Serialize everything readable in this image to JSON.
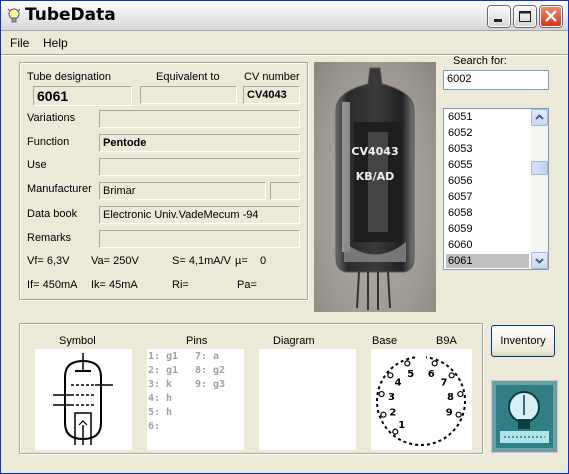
{
  "window": {
    "title": "TubeData"
  },
  "menu": {
    "file": "File",
    "help": "Help"
  },
  "info": {
    "tube_designation_label": "Tube designation",
    "tube_designation": "6061",
    "equivalent_label": "Equivalent to",
    "equivalent": "",
    "cv_number_label": "CV number",
    "cv_number": "CV4043",
    "variations_label": "Variations",
    "variations": "",
    "function_label": "Function",
    "function": "Pentode",
    "use_label": "Use",
    "use": "",
    "manufacturer_label": "Manufacturer",
    "manufacturer": "Brimar",
    "manufacturer_extra": "",
    "data_book_label": "Data book",
    "data_book": "Electronic Univ.VadeMecum -94",
    "remarks_label": "Remarks",
    "remarks": "",
    "params_row1": [
      "Vf= 6,3V",
      "Va= 250V",
      "S= 4,1mA/V",
      "µ=",
      "0"
    ],
    "params_row2": [
      "If= 450mA",
      "Ik= 45mA",
      "Ri=",
      "Pa="
    ]
  },
  "photo": {
    "print_line1": "CV4043",
    "print_line2": "KB/AD"
  },
  "search": {
    "label": "Search for:",
    "value": "6002",
    "results": [
      "6051",
      "6052",
      "6053",
      "6055",
      "6056",
      "6057",
      "6058",
      "6059",
      "6060",
      "6061"
    ],
    "selected": "6061"
  },
  "bottom": {
    "symbol_label": "Symbol",
    "pins_label": "Pins",
    "diagram_label": "Diagram",
    "base_label": "Base",
    "base_type": "B9A",
    "pins_col1": [
      "1: g1",
      "2: g1",
      "3: k",
      "4: h",
      "5: h",
      "6:"
    ],
    "pins_col2": [
      "7: a",
      "8: g2",
      "9: g3"
    ],
    "base_pins": [
      "1",
      "2",
      "3",
      "4",
      "5",
      "6",
      "7",
      "8",
      "9"
    ]
  },
  "buttons": {
    "inventory": "Inventory"
  },
  "colors": {
    "title_bar": "#e6e6e6",
    "close_button": "#d2361a",
    "window_bg": "#ece9d8",
    "selection": "#c0c0c0"
  }
}
